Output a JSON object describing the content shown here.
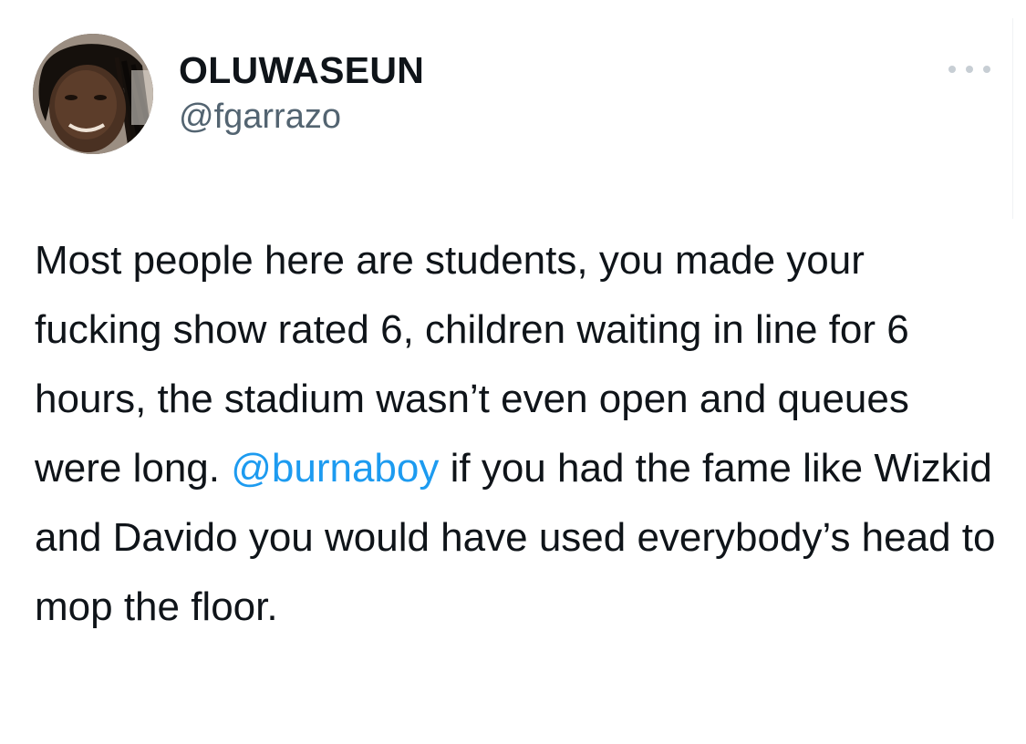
{
  "author": {
    "display_name": "OLUWASEUN",
    "handle": "@fgarrazo",
    "avatar_icon": "profile-photo"
  },
  "more_icon": "more-horizontal-icon",
  "tweet": {
    "text_before_mention": "Most people here are students, you made your fucking show rated 6, children waiting in line for 6 hours, the stadium wasn’t even open and queues were long. ",
    "mention": "@burnaboy",
    "text_after_mention": " if you had the fame like Wizkid and Davido you would have used everybody’s head to mop the floor."
  },
  "colors": {
    "text": "#0f1419",
    "secondary": "#536471",
    "mention": "#1d9bf0",
    "more_dots": "#c7ced4"
  }
}
